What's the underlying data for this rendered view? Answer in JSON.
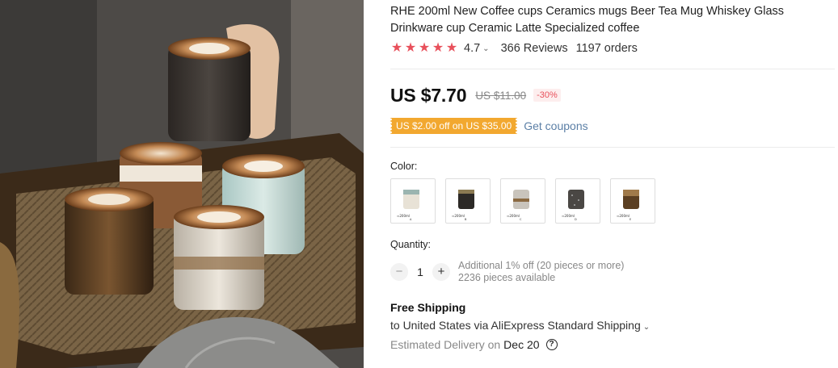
{
  "product": {
    "title": "RHE 200ml New Coffee cups Ceramics mugs Beer Tea Mug Whiskey Glass Drinkware cup Ceramic Latte Specialized coffee",
    "rating": {
      "stars": 5,
      "score": "4.7",
      "reviews": "366 Reviews",
      "orders": "1197 orders"
    },
    "price": "US $7.70",
    "original_price": "US $11.00",
    "discount": "-30%",
    "coupon": "US $2.00 off on US $35.00",
    "get_coupons": "Get coupons",
    "color_label": "Color:",
    "colors": [
      {
        "name": "A",
        "size": "≈200ml",
        "tone": "cream"
      },
      {
        "name": "B",
        "size": "≈200ml",
        "tone": "black-gold"
      },
      {
        "name": "C",
        "size": "≈200ml",
        "tone": "grey-white"
      },
      {
        "name": "D",
        "size": "≈200ml",
        "tone": "dark-speckle"
      },
      {
        "name": "E",
        "size": "≈200ml",
        "tone": "bronze"
      }
    ],
    "quantity_label": "Quantity:",
    "quantity": "1",
    "quantity_note": "Additional 1% off (20 pieces or more)",
    "available": "2236 pieces available",
    "shipping_title": "Free Shipping",
    "shipping_line": "to United States via AliExpress Standard Shipping",
    "delivery_label": "Estimated Delivery on",
    "delivery_date": "Dec 20"
  },
  "colors": {
    "star": "#e8505b",
    "coupon": "#f2a82f",
    "link": "#5b7fa6",
    "discount": "#e8505b"
  }
}
